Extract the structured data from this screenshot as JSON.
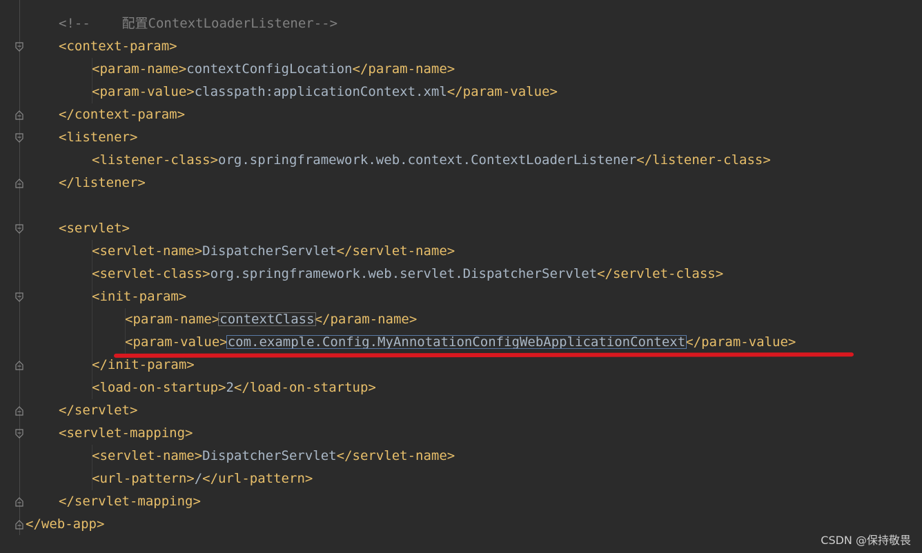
{
  "code_lines": [
    {
      "indent": 1,
      "parts": [
        {
          "t": "cmt",
          "v": "<!--    配置ContextLoaderListener-->"
        }
      ]
    },
    {
      "indent": 1,
      "parts": [
        {
          "t": "tag",
          "v": "<context-param>"
        }
      ]
    },
    {
      "indent": 2,
      "parts": [
        {
          "t": "tag",
          "v": "<param-name>"
        },
        {
          "t": "txt",
          "v": "contextConfigLocation"
        },
        {
          "t": "tag",
          "v": "</param-name>"
        }
      ]
    },
    {
      "indent": 2,
      "parts": [
        {
          "t": "tag",
          "v": "<param-value>"
        },
        {
          "t": "txt",
          "v": "classpath:applicationContext.xml"
        },
        {
          "t": "tag",
          "v": "</param-value>"
        }
      ]
    },
    {
      "indent": 1,
      "parts": [
        {
          "t": "tag",
          "v": "</context-param>"
        }
      ]
    },
    {
      "indent": 1,
      "parts": [
        {
          "t": "tag",
          "v": "<listener>"
        }
      ]
    },
    {
      "indent": 2,
      "parts": [
        {
          "t": "tag",
          "v": "<listener-class>"
        },
        {
          "t": "txt",
          "v": "org.springframework.web.context.ContextLoaderListener"
        },
        {
          "t": "tag",
          "v": "</listener-class>"
        }
      ]
    },
    {
      "indent": 1,
      "parts": [
        {
          "t": "tag",
          "v": "</listener>"
        }
      ]
    },
    {
      "indent": 0,
      "parts": []
    },
    {
      "indent": 1,
      "parts": [
        {
          "t": "tag",
          "v": "<servlet>"
        }
      ]
    },
    {
      "indent": 2,
      "parts": [
        {
          "t": "tag",
          "v": "<servlet-name>"
        },
        {
          "t": "txt",
          "v": "DispatcherServlet"
        },
        {
          "t": "tag",
          "v": "</servlet-name>"
        }
      ]
    },
    {
      "indent": 2,
      "parts": [
        {
          "t": "tag",
          "v": "<servlet-class>"
        },
        {
          "t": "txt",
          "v": "org.springframework.web.servlet.DispatcherServlet"
        },
        {
          "t": "tag",
          "v": "</servlet-class>"
        }
      ]
    },
    {
      "indent": 2,
      "parts": [
        {
          "t": "tag",
          "v": "<init-param>"
        }
      ]
    },
    {
      "indent": 3,
      "parts": [
        {
          "t": "tag",
          "v": "<param-name>"
        },
        {
          "t": "txt",
          "v": "contextClass"
        },
        {
          "t": "tag",
          "v": "</param-name>"
        }
      ]
    },
    {
      "indent": 3,
      "parts": [
        {
          "t": "tag",
          "v": "<param-value>"
        },
        {
          "t": "txt",
          "v": "com.example.Config.MyAnnotationConfigWebApplicationContext"
        },
        {
          "t": "tag",
          "v": "</param-value>"
        }
      ]
    },
    {
      "indent": 2,
      "parts": [
        {
          "t": "tag",
          "v": "</init-param>"
        }
      ]
    },
    {
      "indent": 2,
      "parts": [
        {
          "t": "tag",
          "v": "<load-on-startup>"
        },
        {
          "t": "txt",
          "v": "2"
        },
        {
          "t": "tag",
          "v": "</load-on-startup>"
        }
      ]
    },
    {
      "indent": 1,
      "parts": [
        {
          "t": "tag",
          "v": "</servlet>"
        }
      ]
    },
    {
      "indent": 1,
      "parts": [
        {
          "t": "tag",
          "v": "<servlet-mapping>"
        }
      ]
    },
    {
      "indent": 2,
      "parts": [
        {
          "t": "tag",
          "v": "<servlet-name>"
        },
        {
          "t": "txt",
          "v": "DispatcherServlet"
        },
        {
          "t": "tag",
          "v": "</servlet-name>"
        }
      ]
    },
    {
      "indent": 2,
      "parts": [
        {
          "t": "tag",
          "v": "<url-pattern>"
        },
        {
          "t": "txt",
          "v": "/"
        },
        {
          "t": "tag",
          "v": "</url-pattern>"
        }
      ]
    },
    {
      "indent": 1,
      "parts": [
        {
          "t": "tag",
          "v": "</servlet-mapping>"
        }
      ]
    },
    {
      "indent": 0,
      "parts": [
        {
          "t": "tag",
          "v": "</web-app>"
        }
      ]
    }
  ],
  "watermark": "CSDN @保持敬畏",
  "colors": {
    "background": "#2b2b2b",
    "tag": "#e8bf6a",
    "text": "#a9b7c6",
    "comment": "#808080",
    "highlight_underline": "#d9181f",
    "selection_box": "#5a7ba8"
  }
}
